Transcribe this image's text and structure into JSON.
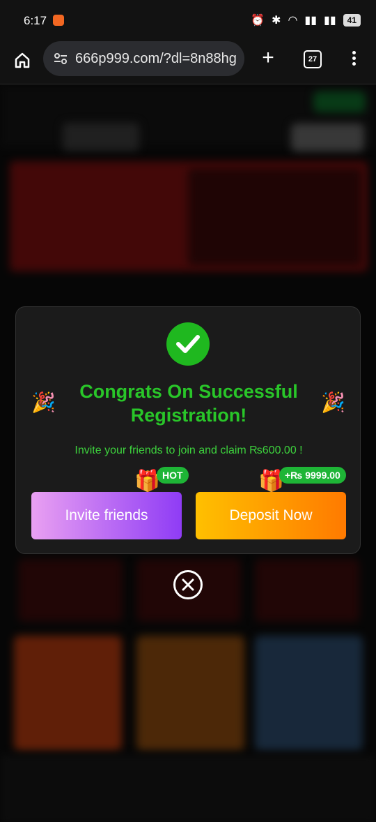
{
  "status_bar": {
    "time": "6:17",
    "battery": "41"
  },
  "browser": {
    "url": "666p999.com/?dl=8n88hg",
    "tab_count": "27"
  },
  "modal": {
    "title": "Congrats On Successful Registration!",
    "subtitle": "Invite your friends to join and claim ₨600.00 !",
    "invite_label": "Invite friends",
    "invite_badge": "HOT",
    "deposit_label": "Deposit Now",
    "deposit_badge": "+₨ 9999.00"
  },
  "colors": {
    "accent_green": "#29c629",
    "invite_gradient": [
      "#e9a0f2",
      "#8f3cf5"
    ],
    "deposit_gradient": [
      "#ffc000",
      "#ff7a00"
    ]
  }
}
